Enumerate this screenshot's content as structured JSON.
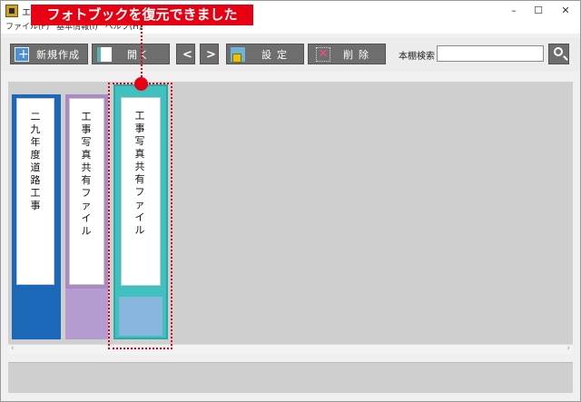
{
  "window": {
    "title": "エ",
    "min_label": "–",
    "max_label": "☐",
    "close_label": "✕"
  },
  "menu": {
    "items": [
      "ファイル(F)",
      "基本情報(I)",
      "ヘルプ(H)"
    ]
  },
  "callout": {
    "text": "フォトブックを復元できました",
    "color": "#e60012"
  },
  "toolbar": {
    "new_label": "新規作成",
    "open_label": "開く",
    "prev_label": "<",
    "next_label": ">",
    "settings_label": "設定",
    "delete_label": "削除",
    "delete_icon": "✕",
    "search_label": "本棚検索",
    "search_value": ""
  },
  "shelf": {
    "scroll_left": "‹",
    "scroll_right": "›",
    "binders": [
      {
        "title": "二九年度 道路工事",
        "color": "#1b68b8"
      },
      {
        "title": "工事写真 共有ファイル",
        "color": "#a98bc4"
      },
      {
        "title": "工事写真 共有ファイル",
        "color": "#3fc1c0",
        "selected": true
      }
    ]
  }
}
